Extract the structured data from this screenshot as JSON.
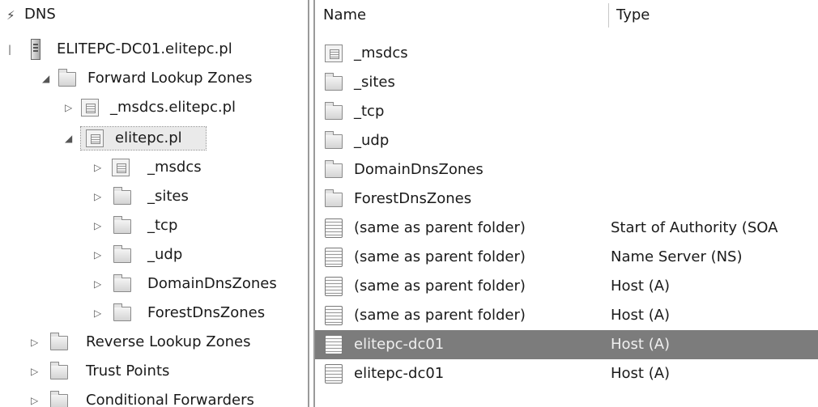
{
  "tree": {
    "root_label": "DNS",
    "server_label": "ELITEPC-DC01.elitepc.pl",
    "items": [
      {
        "label": "Forward Lookup Zones",
        "expander": "◢"
      },
      {
        "label": "_msdcs.elitepc.pl",
        "expander": "▷"
      },
      {
        "label": "elitepc.pl",
        "expander": "◢"
      },
      {
        "label": "_msdcs",
        "expander": "▷"
      },
      {
        "label": "_sites",
        "expander": "▷"
      },
      {
        "label": "_tcp",
        "expander": "▷"
      },
      {
        "label": "_udp",
        "expander": "▷"
      },
      {
        "label": "DomainDnsZones",
        "expander": "▷"
      },
      {
        "label": "ForestDnsZones",
        "expander": "▷"
      },
      {
        "label": "Reverse Lookup Zones",
        "expander": "▷"
      },
      {
        "label": "Trust Points",
        "expander": "▷"
      },
      {
        "label": "Conditional Forwarders",
        "expander": "▷"
      }
    ]
  },
  "list": {
    "columns": {
      "name": "Name",
      "type": "Type"
    },
    "rows": [
      {
        "name": "_msdcs",
        "type": ""
      },
      {
        "name": "_sites",
        "type": ""
      },
      {
        "name": "_tcp",
        "type": ""
      },
      {
        "name": "_udp",
        "type": ""
      },
      {
        "name": "DomainDnsZones",
        "type": ""
      },
      {
        "name": "ForestDnsZones",
        "type": ""
      },
      {
        "name": "(same as parent folder)",
        "type": "Start of Authority (SOA"
      },
      {
        "name": "(same as parent folder)",
        "type": "Name Server (NS)"
      },
      {
        "name": "(same as parent folder)",
        "type": "Host (A)"
      },
      {
        "name": "(same as parent folder)",
        "type": "Host (A)"
      },
      {
        "name": "elitepc-dc01",
        "type": "Host (A)"
      },
      {
        "name": "elitepc-dc01",
        "type": "Host (A)"
      }
    ]
  },
  "colors": {
    "selected_row": "#7c7c7c",
    "selected_text": "#f0f0f0"
  }
}
